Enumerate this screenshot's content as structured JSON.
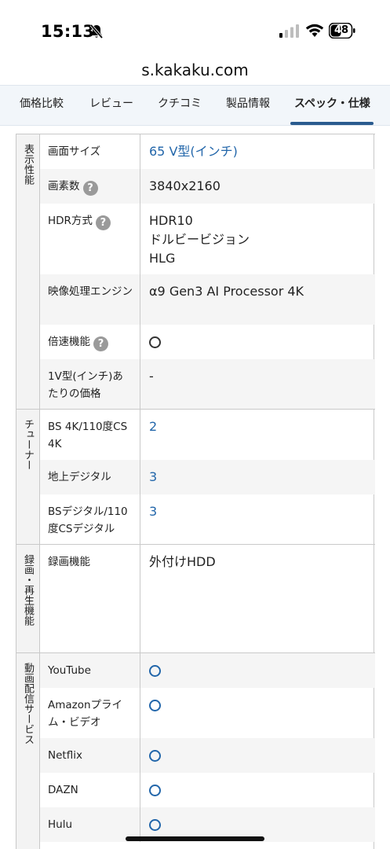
{
  "status": {
    "time": "15:13",
    "battery": "48"
  },
  "url": "s.kakaku.com",
  "tabs": [
    {
      "label": "価格比較"
    },
    {
      "label": "レビュー"
    },
    {
      "label": "クチコミ"
    },
    {
      "label": "製品情報"
    },
    {
      "label": "スペック・仕様"
    }
  ],
  "active_tab": "スペック・仕様",
  "groups": [
    {
      "label": "表示性能",
      "rows": [
        {
          "label": "画面サイズ",
          "value": "65 V型(インチ)",
          "link": true
        },
        {
          "label": "画素数",
          "value": "3840x2160",
          "help": true
        },
        {
          "label": "HDR方式",
          "value": "HDR10\nドルビービジョン\nHLG",
          "help": true
        },
        {
          "label": "映像処理エンジン",
          "value": "α9 Gen3 AI Processor 4K"
        },
        {
          "label": "倍速機能",
          "value": "○",
          "help": true
        },
        {
          "label": "1V型(インチ)あたりの価格",
          "value": "-"
        }
      ]
    },
    {
      "label": "チューナー",
      "rows": [
        {
          "label": "BS 4K/110度CS 4K",
          "value": "2",
          "link": true
        },
        {
          "label": "地上デジタル",
          "value": "3",
          "link": true
        },
        {
          "label": "BSデジタル/110度CSデジタル",
          "value": "3",
          "link": true
        }
      ]
    },
    {
      "label": "録画・再生機能",
      "rows": [
        {
          "label": "録画機能",
          "value": "外付けHDD"
        }
      ]
    },
    {
      "label": "動画配信サービス",
      "rows": [
        {
          "label": "YouTube",
          "value": "○",
          "link": true
        },
        {
          "label": "Amazonプライム・ビデオ",
          "value": "○",
          "link": true
        },
        {
          "label": "Netflix",
          "value": "○",
          "link": true
        },
        {
          "label": "DAZN",
          "value": "○",
          "link": true
        },
        {
          "label": "Hulu",
          "value": "○",
          "link": true
        }
      ]
    }
  ],
  "colors": {
    "link": "#2266aa",
    "tab_underline": "#2a5b8f",
    "tab_bar_bg": "#f2f6fa"
  },
  "icons": [
    "bell-off-icon",
    "signal-icon",
    "wifi-icon",
    "battery-icon",
    "question-icon",
    "circle-mark-icon"
  ]
}
